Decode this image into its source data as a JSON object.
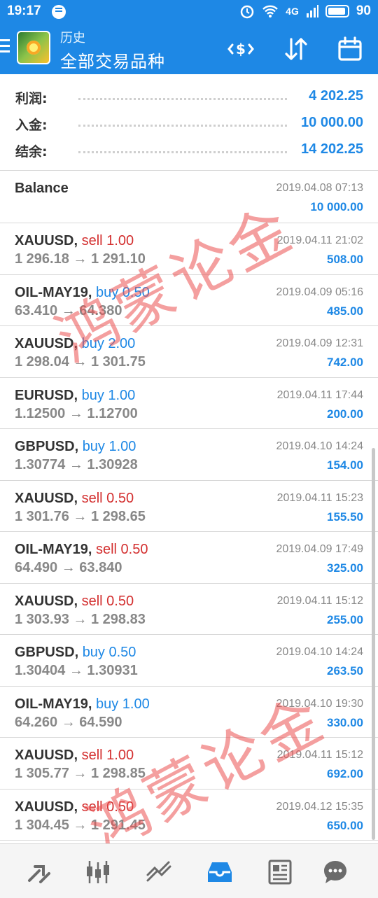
{
  "status_bar": {
    "time": "19:17",
    "signal": "4G",
    "battery": "90"
  },
  "app_bar": {
    "subtitle": "历史",
    "title": "全部交易品种"
  },
  "summary": [
    {
      "label": "利润:",
      "value": "4 202.25"
    },
    {
      "label": "入金:",
      "value": "10 000.00"
    },
    {
      "label": "结余:",
      "value": "14 202.25"
    }
  ],
  "balance_entry": {
    "label": "Balance",
    "datetime": "2019.04.08 07:13",
    "amount": "10 000.00"
  },
  "deals": [
    {
      "symbol": "XAUUSD,",
      "side": "sell",
      "volume": "sell 1.00",
      "prices": "1 296.18 → 1 291.10",
      "datetime": "2019.04.11 21:02",
      "profit": "508.00"
    },
    {
      "symbol": "OIL-MAY19,",
      "side": "buy",
      "volume": "buy 0.50",
      "prices": "63.410 → 64.380",
      "datetime": "2019.04.09 05:16",
      "profit": "485.00"
    },
    {
      "symbol": "XAUUSD,",
      "side": "buy",
      "volume": "buy 2.00",
      "prices": "1 298.04 → 1 301.75",
      "datetime": "2019.04.09 12:31",
      "profit": "742.00"
    },
    {
      "symbol": "EURUSD,",
      "side": "buy",
      "volume": "buy 1.00",
      "prices": "1.12500 → 1.12700",
      "datetime": "2019.04.11 17:44",
      "profit": "200.00"
    },
    {
      "symbol": "GBPUSD,",
      "side": "buy",
      "volume": "buy 1.00",
      "prices": "1.30774 → 1.30928",
      "datetime": "2019.04.10 14:24",
      "profit": "154.00"
    },
    {
      "symbol": "XAUUSD,",
      "side": "sell",
      "volume": "sell 0.50",
      "prices": "1 301.76 → 1 298.65",
      "datetime": "2019.04.11 15:23",
      "profit": "155.50"
    },
    {
      "symbol": "OIL-MAY19,",
      "side": "sell",
      "volume": "sell 0.50",
      "prices": "64.490 → 63.840",
      "datetime": "2019.04.09 17:49",
      "profit": "325.00"
    },
    {
      "symbol": "XAUUSD,",
      "side": "sell",
      "volume": "sell 0.50",
      "prices": "1 303.93 → 1 298.83",
      "datetime": "2019.04.11 15:12",
      "profit": "255.00"
    },
    {
      "symbol": "GBPUSD,",
      "side": "buy",
      "volume": "buy 0.50",
      "prices": "1.30404 → 1.30931",
      "datetime": "2019.04.10 14:24",
      "profit": "263.50"
    },
    {
      "symbol": "OIL-MAY19,",
      "side": "buy",
      "volume": "buy 1.00",
      "prices": "64.260 → 64.590",
      "datetime": "2019.04.10 19:30",
      "profit": "330.00"
    },
    {
      "symbol": "XAUUSD,",
      "side": "sell",
      "volume": "sell 1.00",
      "prices": "1 305.77 → 1 298.85",
      "datetime": "2019.04.11 15:12",
      "profit": "692.00"
    },
    {
      "symbol": "XAUUSD,",
      "side": "sell",
      "volume": "sell 0.50",
      "prices": "1 304.45 → 1 291.45",
      "datetime": "2019.04.12 15:35",
      "profit": "650.00"
    }
  ],
  "toolbar_icons": [
    "currency-exchange-icon",
    "sort-icon",
    "calendar-icon"
  ],
  "bottom_nav": [
    "quotes-icon",
    "chart-icon",
    "trade-icon",
    "history-icon",
    "news-icon",
    "messages-icon"
  ],
  "watermark": {
    "text_1": "鸿蒙论金",
    "text_2": "鸿蒙论金"
  },
  "colors": {
    "accent": "#1e88e5",
    "sell": "#d32f2f",
    "buy": "#1e88e5"
  }
}
